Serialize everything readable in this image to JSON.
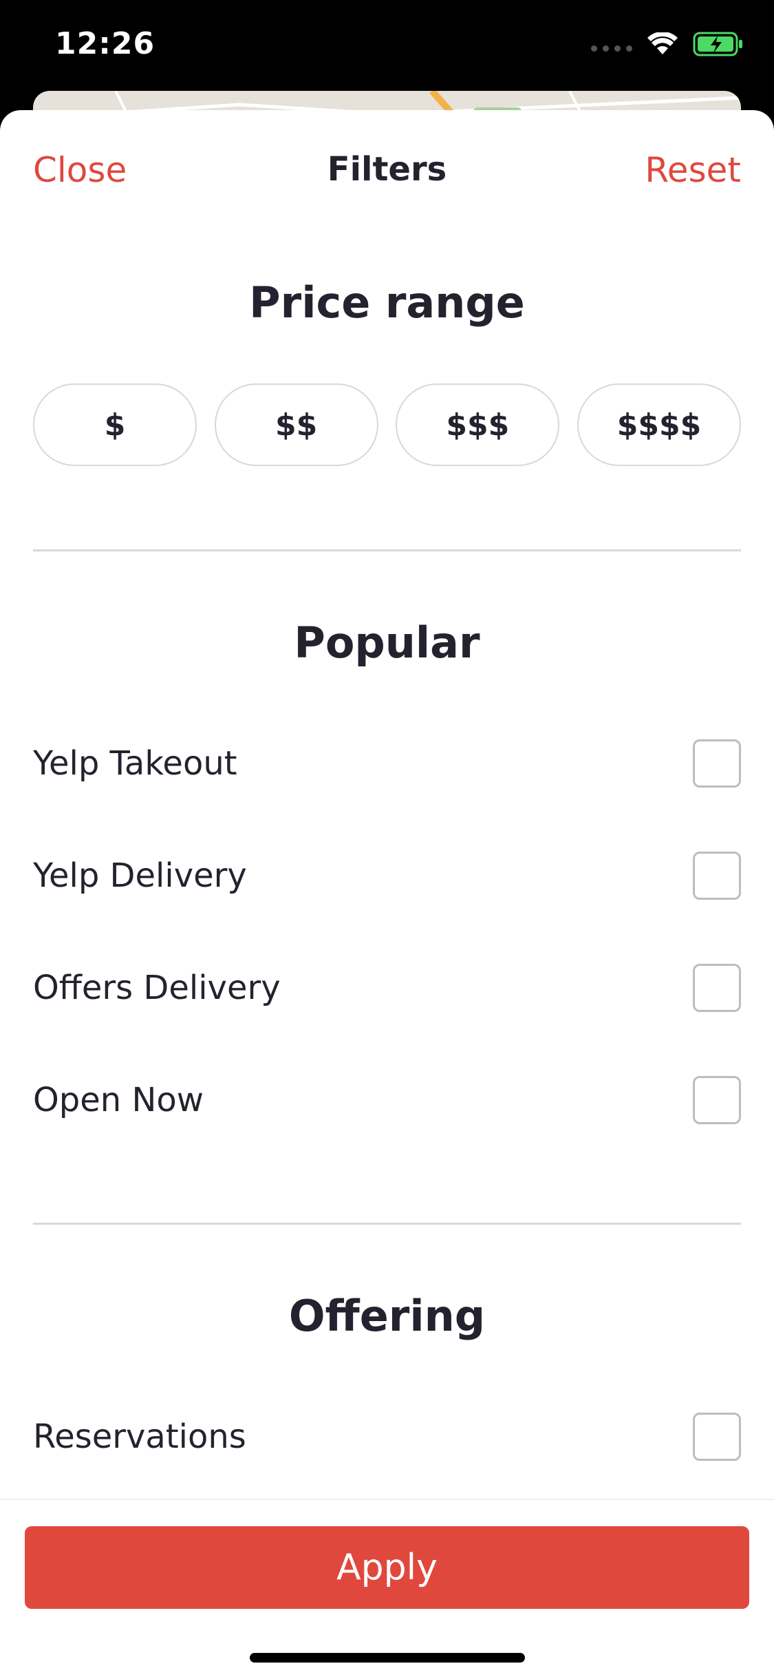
{
  "status_bar": {
    "time": "12:26",
    "icons": [
      "cellular-signal-icon",
      "wifi-icon",
      "battery-charging-icon"
    ]
  },
  "nav": {
    "close_label": "Close",
    "title": "Filters",
    "reset_label": "Reset"
  },
  "price_range": {
    "title": "Price range",
    "options": [
      "$",
      "$$",
      "$$$",
      "$$$$"
    ]
  },
  "popular": {
    "title": "Popular",
    "items": [
      {
        "label": "Yelp Takeout",
        "checked": false
      },
      {
        "label": "Yelp Delivery",
        "checked": false
      },
      {
        "label": "Offers Delivery",
        "checked": false
      },
      {
        "label": "Open Now",
        "checked": false
      }
    ]
  },
  "offering": {
    "title": "Offering",
    "items": [
      {
        "label": "Reservations",
        "checked": false
      }
    ]
  },
  "footer": {
    "apply_label": "Apply"
  },
  "colors": {
    "accent": "#e0483e",
    "text": "#23232f",
    "divider": "#d8d8d8"
  }
}
